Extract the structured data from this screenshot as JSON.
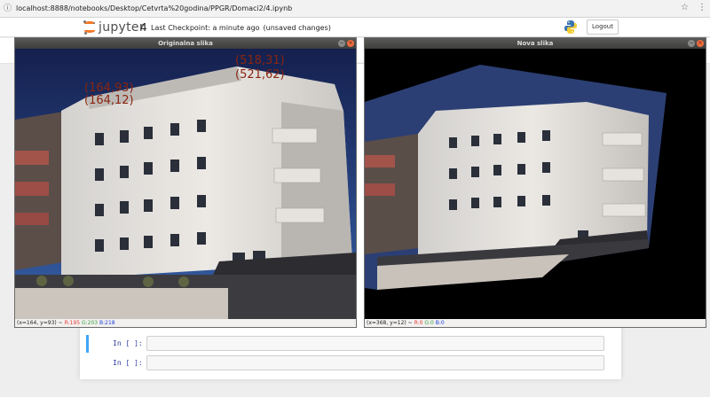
{
  "browser": {
    "url": "localhost:8888/notebooks/Desktop/Cetvrta%20godina/PPGR/Domaci2/4.ipynb",
    "icons": [
      "bookmark-star-icon",
      "kebab-menu-icon"
    ]
  },
  "header": {
    "logo_text": "jupyter",
    "notebook_name": "4",
    "checkpoint": "Last Checkpoint: a minute ago",
    "unsaved": "(unsaved changes)",
    "logout_label": "Logout"
  },
  "windows": {
    "original": {
      "title": "Originalna slika",
      "points": [
        {
          "text": "(164,93)"
        },
        {
          "text": "(164,12)"
        },
        {
          "text": "(518,31)"
        },
        {
          "text": "(521,62)"
        }
      ],
      "status": {
        "coords": "(x=164, y=93) ~ ",
        "r": "R:195",
        "g": "G:203",
        "b": "B:218"
      }
    },
    "new": {
      "title": "Nova slika",
      "status": {
        "coords": "(x=368, y=12) ~ ",
        "r": "R:0",
        "g": "G:0",
        "b": "B:0"
      }
    }
  },
  "cells": [
    {
      "prompt": "In [ ]:"
    },
    {
      "prompt": "In [ ]:"
    }
  ],
  "colors": {
    "jupyter_orange": "#f37726",
    "cell_selected": "#42a5f5",
    "point_label": "#8a2410"
  }
}
